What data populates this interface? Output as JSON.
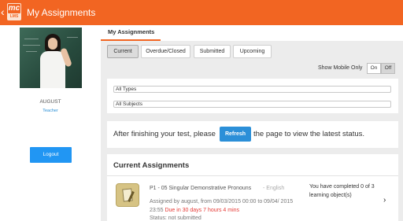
{
  "app": {
    "title": "My Assignments",
    "logo_text": "mc",
    "logo_sub": "LMS",
    "back_icon": "chevron-left-icon"
  },
  "sidebar": {
    "user_name": "AUGUST",
    "user_role": "Teacher",
    "logout_label": "Logout"
  },
  "main": {
    "page_tab": "My Assignments",
    "filter_tabs": [
      {
        "label": "Current",
        "active": true
      },
      {
        "label": "Overdue/Closed",
        "active": false
      },
      {
        "label": "Submitted",
        "active": false
      },
      {
        "label": "Upcoming",
        "active": false
      }
    ],
    "mobile_only_label": "Show Mobile Only",
    "toggle_on": "On",
    "toggle_off": "Off",
    "type_select": "All Types",
    "subject_select": "All Subjects",
    "refresh_msg_before": "After finishing your test, please",
    "refresh_button": "Refresh",
    "refresh_msg_after": "the page to view the latest status.",
    "assignments_title": "Current Assignments",
    "assignment": {
      "title": "P1 - 05 Singular Demonstrative Pronouns",
      "language": "- English",
      "assigned_text": "Assigned by august, from 09/03/2015 00:00 to 09/04/ 2015 23:55",
      "due_text": "Due in 30 days 7 hours 4 mins",
      "status": "Status: not submitted",
      "progress": "You have completed 0 of 3 learning object(s)",
      "chevron": "›"
    }
  },
  "colors": {
    "brand": "#f26522",
    "accent_blue": "#2196f3",
    "due_red": "#e53935"
  }
}
